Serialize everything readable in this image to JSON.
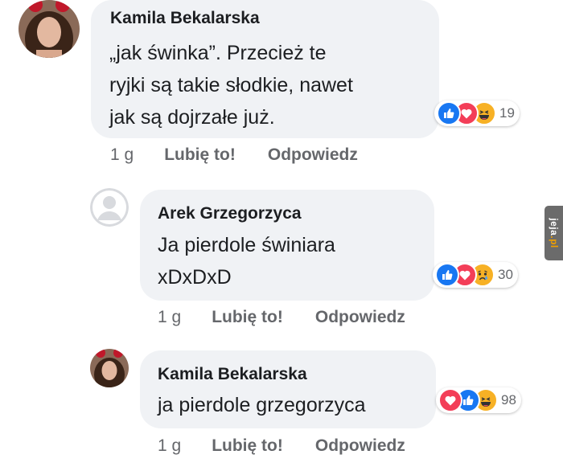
{
  "comments": [
    {
      "author": "Kamila Bekalarska",
      "text": "„jak świnka”. Przecież te\nryjki są takie słodkie, nawet\njak są dojrzałe już.",
      "reaction_count": "19",
      "time": "1 g",
      "like_label": "Lubię to!",
      "reply_label": "Odpowiedz",
      "reactions": [
        "like-icon",
        "love-icon",
        "haha-icon"
      ]
    },
    {
      "author": "Arek Grzegorzyca",
      "text": "Ja pierdole świniara\nxDxDxD",
      "reaction_count": "30",
      "time": "1 g",
      "like_label": "Lubię to!",
      "reply_label": "Odpowiedz",
      "reactions": [
        "like-icon",
        "love-icon",
        "sad-icon"
      ]
    },
    {
      "author": "Kamila Bekalarska",
      "text": "ja pierdole grzegorzyca",
      "reaction_count": "98",
      "time": "1 g",
      "like_label": "Lubię to!",
      "reply_label": "Odpowiedz",
      "reactions": [
        "love-icon",
        "like-icon",
        "haha-icon"
      ]
    }
  ],
  "watermark": {
    "text": "jeja",
    "suffix": ".pl"
  },
  "colors": {
    "bubble": "#f0f2f5",
    "like": "#1877f2",
    "love": "#f33e58",
    "haha": "#f7b125",
    "meta_text": "#65676b"
  }
}
